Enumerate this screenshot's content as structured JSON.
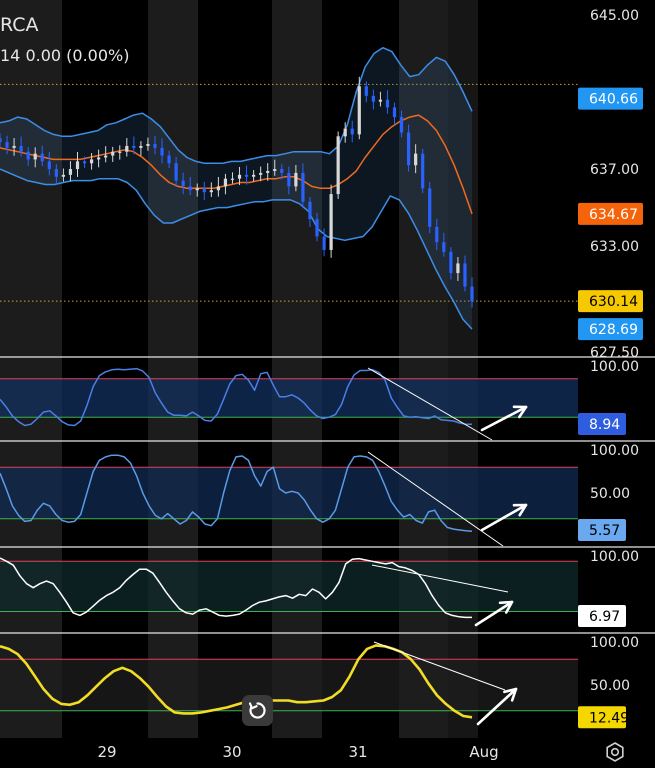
{
  "header": {
    "symbol": "RCA",
    "change": "14  0.00 (0.00%)"
  },
  "colors": {
    "candle_down": "#2962ff",
    "candle_up": "#d8d8d8",
    "bb_band": "#3d8ee8",
    "bb_basis": "#f06a1e",
    "osc1": "#4a7fe8",
    "osc2": "#5a9be8",
    "osc3": "#ffffff",
    "osc4": "#f2dc24",
    "upper_level": "#e0405a",
    "lower_level": "#3fb24c",
    "dotted_level": "#c9a33a",
    "pane_divider": "#e6e6e6"
  },
  "icons": {
    "reset": "reset-icon",
    "settings": "settings-gear-icon"
  },
  "chart_data": [
    {
      "type": "candlestick",
      "pane": "price",
      "x_labels": [
        "29",
        "30",
        "31",
        "Aug"
      ],
      "y_ticks": [
        645.0,
        637.0,
        633.0,
        627.5
      ],
      "ylim": [
        627.5,
        645.0
      ],
      "price_tags": [
        {
          "label": "640.66",
          "color": "#2196f3",
          "text_color": "#ffffff",
          "series": "bb_upper"
        },
        {
          "label": "634.67",
          "color": "#f5640a",
          "text_color": "#ffffff",
          "series": "bb_basis"
        },
        {
          "label": "630.14",
          "color": "#f5c800",
          "text_color": "#000000",
          "series": "last_price"
        },
        {
          "label": "628.69",
          "color": "#2196f3",
          "text_color": "#ffffff",
          "series": "bb_lower"
        }
      ],
      "dotted_levels": [
        641.4,
        630.14
      ],
      "close": [
        638.4,
        638.1,
        638.2,
        637.9,
        637.5,
        637.8,
        637.4,
        637.0,
        636.6,
        636.7,
        637.0,
        637.4,
        637.3,
        637.5,
        637.6,
        637.7,
        637.9,
        637.9,
        638.2,
        638.1,
        638.2,
        638.3,
        638.1,
        637.7,
        637.3,
        636.4,
        636.1,
        635.9,
        636.0,
        635.8,
        635.9,
        636.1,
        636.5,
        636.5,
        636.7,
        636.6,
        636.7,
        636.8,
        636.9,
        637.0,
        636.8,
        636.1,
        636.8,
        635.3,
        634.4,
        633.5,
        632.8,
        635.7,
        638.7,
        639.1,
        638.8,
        641.3,
        640.8,
        640.5,
        640.6,
        640.2,
        639.7,
        638.9,
        637.2,
        637.8,
        636.0,
        634.0,
        633.2,
        632.7,
        631.6,
        632.1,
        630.9,
        630.14
      ],
      "bb_upper": [
        639.4,
        639.5,
        639.7,
        639.6,
        639.3,
        639.0,
        638.8,
        638.7,
        638.7,
        638.8,
        638.9,
        639.0,
        639.3,
        639.4,
        639.6,
        639.8,
        639.9,
        639.6,
        639.2,
        638.6,
        638.0,
        637.6,
        637.4,
        637.3,
        637.3,
        637.3,
        637.4,
        637.4,
        637.5,
        637.6,
        637.7,
        637.7,
        637.8,
        637.9,
        637.9,
        637.9,
        637.9,
        637.8,
        638.2,
        639.3,
        641.0,
        642.3,
        643.0,
        643.3,
        643.1,
        642.4,
        641.8,
        641.9,
        642.4,
        642.8,
        642.6,
        641.9,
        641.0,
        640.0
      ],
      "bb_basis": [
        638.1,
        638.0,
        637.9,
        637.8,
        637.7,
        637.6,
        637.5,
        637.5,
        637.5,
        637.5,
        637.6,
        637.7,
        637.8,
        637.9,
        638.0,
        637.9,
        637.6,
        637.2,
        636.7,
        636.3,
        636.1,
        636.0,
        636.0,
        636.0,
        636.0,
        636.1,
        636.2,
        636.3,
        636.3,
        636.4,
        636.5,
        636.5,
        636.6,
        636.6,
        636.4,
        636.1,
        636.0,
        636.0,
        636.2,
        636.5,
        636.9,
        637.6,
        638.2,
        638.8,
        639.2,
        639.5,
        639.7,
        639.8,
        639.5,
        639.0,
        638.2,
        637.2,
        636.0,
        634.67
      ],
      "bb_lower": [
        637.0,
        636.8,
        636.6,
        636.4,
        636.3,
        636.2,
        636.2,
        636.3,
        636.4,
        636.4,
        636.4,
        636.5,
        636.5,
        636.5,
        636.3,
        635.9,
        635.2,
        634.6,
        634.2,
        634.2,
        634.4,
        634.6,
        634.8,
        634.9,
        635.0,
        635.0,
        635.1,
        635.2,
        635.3,
        635.3,
        635.4,
        635.4,
        635.4,
        635.2,
        634.8,
        633.9,
        633.5,
        633.4,
        633.3,
        633.4,
        633.5,
        634.0,
        634.8,
        635.6,
        635.4,
        634.7,
        633.8,
        632.8,
        631.8,
        630.9,
        630.1,
        629.2,
        628.69
      ]
    },
    {
      "type": "line",
      "pane": "oscillator-1",
      "y_ticks": [
        100.0
      ],
      "ylim": [
        0,
        100
      ],
      "levels": {
        "upper": 80,
        "lower": 20
      },
      "last_value_label": "8.94",
      "values": [
        48,
        36,
        22,
        13,
        7,
        9,
        18,
        28,
        30,
        22,
        13,
        8,
        7,
        14,
        38,
        68,
        85,
        91,
        94,
        95,
        94,
        95,
        96,
        92,
        82,
        58,
        42,
        28,
        23,
        23,
        22,
        28,
        22,
        15,
        14,
        25,
        48,
        72,
        85,
        87,
        78,
        62,
        88,
        90,
        70,
        52,
        52,
        55,
        50,
        42,
        31,
        22,
        18,
        20,
        24,
        40,
        68,
        86,
        93,
        93,
        94,
        90,
        78,
        50,
        35,
        22,
        20,
        21,
        19,
        18,
        22,
        16,
        15,
        14,
        11,
        9,
        8.94
      ],
      "annotation_arrow_dir": "up-right"
    },
    {
      "type": "line",
      "pane": "oscillator-2",
      "y_ticks": [
        100.0,
        50.0
      ],
      "ylim": [
        0,
        100
      ],
      "levels": {
        "upper": 80,
        "lower": 20
      },
      "last_value_label": "5.57",
      "values": [
        73,
        55,
        35,
        24,
        17,
        18,
        30,
        38,
        35,
        25,
        18,
        16,
        17,
        25,
        50,
        75,
        88,
        92,
        94,
        94,
        92,
        85,
        70,
        50,
        35,
        24,
        20,
        26,
        20,
        14,
        18,
        28,
        22,
        14,
        12,
        20,
        50,
        76,
        92,
        93,
        88,
        70,
        58,
        75,
        80,
        55,
        50,
        52,
        50,
        42,
        30,
        20,
        16,
        20,
        30,
        55,
        80,
        92,
        93,
        92,
        88,
        75,
        58,
        40,
        30,
        22,
        25,
        18,
        15,
        28,
        30,
        18,
        10,
        8,
        7,
        6,
        5.57
      ],
      "annotation_arrow_dir": "up-right"
    },
    {
      "type": "line",
      "pane": "oscillator-3",
      "y_ticks": [
        100.0
      ],
      "ylim": [
        0,
        100
      ],
      "levels": {
        "upper": 92,
        "lower": 16
      },
      "last_value_label": "6.97",
      "values": [
        97,
        92,
        86,
        70,
        58,
        52,
        58,
        62,
        58,
        45,
        30,
        14,
        10,
        15,
        24,
        33,
        40,
        45,
        52,
        63,
        72,
        80,
        80,
        74,
        60,
        45,
        32,
        20,
        14,
        12,
        18,
        20,
        15,
        10,
        9,
        10,
        12,
        18,
        25,
        30,
        32,
        35,
        38,
        40,
        36,
        42,
        40,
        50,
        45,
        35,
        45,
        60,
        88,
        95,
        96,
        94,
        92,
        90,
        88,
        90,
        84,
        82,
        78,
        72,
        58,
        40,
        25,
        14,
        10,
        8,
        7,
        6.97
      ],
      "annotation_arrow_dir": "up-right"
    },
    {
      "type": "line",
      "pane": "oscillator-4",
      "y_ticks": [
        100.0,
        50.0
      ],
      "ylim": [
        0,
        100
      ],
      "levels": {
        "upper": 80,
        "lower": 20
      },
      "last_value_label": "12.49",
      "values": [
        95,
        92,
        86,
        75,
        60,
        45,
        34,
        28,
        27,
        30,
        38,
        48,
        58,
        66,
        70,
        66,
        58,
        48,
        36,
        25,
        18,
        17,
        17,
        18,
        20,
        22,
        24,
        27,
        30,
        34,
        33,
        32,
        32,
        32,
        30,
        30,
        31,
        32,
        36,
        44,
        60,
        80,
        92,
        96,
        95,
        92,
        88,
        80,
        68,
        52,
        38,
        28,
        20,
        14,
        12.49
      ],
      "annotation_arrow_dir": "up-right"
    }
  ]
}
